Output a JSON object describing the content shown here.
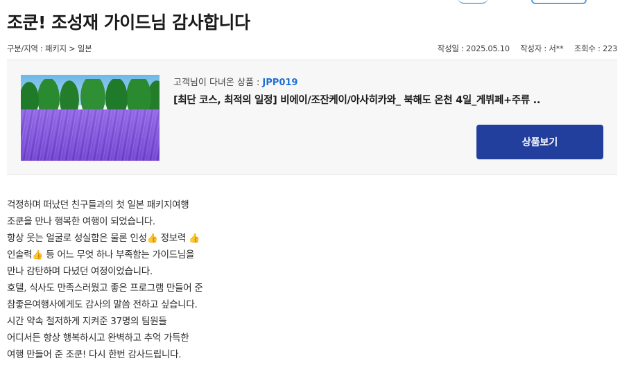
{
  "post": {
    "title": "조쿤! 조성재 가이드님 감사합니다",
    "category": "구분/지역 : 패키지 > 일본",
    "date": "작성일 : 2025.05.10",
    "author": "작성자 : 서**",
    "views": "조회수 : 223"
  },
  "product": {
    "label": "고객님이 다녀온 상품 :",
    "code": "JPP019",
    "name": "[최단 코스, 최적의 일정] 비에이/조잔케이/아사히카와_ 북해도 온천 4일_게뷔페+주류 ..",
    "button_label": "상품보기"
  },
  "body": {
    "lines": [
      "걱정하며 떠났던 친구들과의 첫 일본 패키지여행",
      "조쿤을 만나 행복한 여행이 되었습니다.",
      "항상 웃는 얼굴로 성실함은 물론 인성",
      "정보력",
      "인솔력",
      "등 어느 무엇 하나 부족함는 가이드님을",
      "만나 감탄하며 다녔던 여정이었습니다.",
      "호텔, 식사도 만족스러웠고 좋은 프로그램 만들어 준",
      "참좋은여행사에게도 감사의 말씀 전하고 싶습니다.",
      "시간 약속 철저하게 지켜준 37명의 팀원들",
      "어디서든 항상 행복하시고  완벽하고 추억 가득한",
      "여행 만들어 준 조쿤! 다시 한번 감사드립니다."
    ],
    "emoji": "👍"
  }
}
